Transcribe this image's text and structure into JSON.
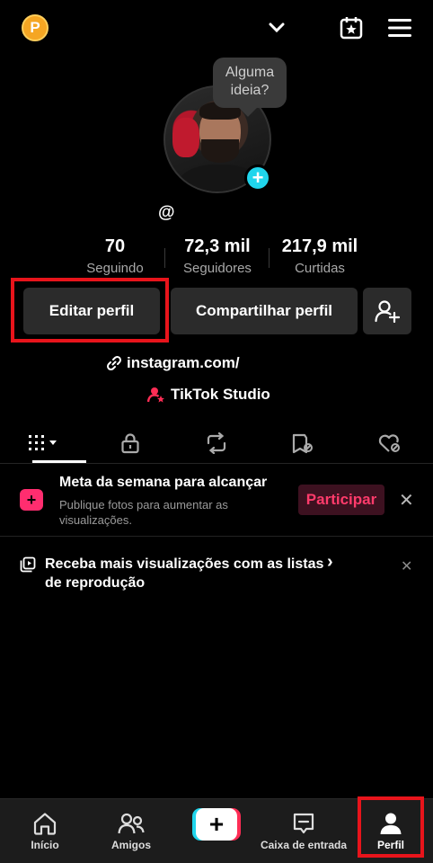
{
  "header": {
    "coin_letter": "P",
    "icons": [
      "coin-icon",
      "chevron-down-icon",
      "calendar-star-icon",
      "menu-icon"
    ]
  },
  "profile": {
    "bubble_text": "Alguma ideia?",
    "handle": "@",
    "stats": [
      {
        "value": "70",
        "label": "Seguindo"
      },
      {
        "value": "72,3 mil",
        "label": "Seguidores"
      },
      {
        "value": "217,9 mil",
        "label": "Curtidas"
      }
    ],
    "buttons": {
      "edit": "Editar perfil",
      "share": "Compartilhar perfil"
    },
    "link": "instagram.com/",
    "studio": "TikTok Studio"
  },
  "tabs": [
    "videos-grid-icon",
    "lock-icon",
    "repost-icon",
    "favorites-icon",
    "liked-icon"
  ],
  "meta_card": {
    "title": "Meta da semana para alcançar",
    "subtitle": "Publique fotos para aumentar as visualizações.",
    "cta": "Participar",
    "close": "✕"
  },
  "playlist_card": {
    "text": "Receba mais visualizações com as listas de reprodução",
    "chevron": "›",
    "close": "✕"
  },
  "bottom_nav": {
    "items": [
      {
        "label": "Início",
        "icon": "home-icon"
      },
      {
        "label": "Amigos",
        "icon": "friends-icon"
      },
      {
        "label": "",
        "icon": "create-icon"
      },
      {
        "label": "Caixa de entrada",
        "icon": "inbox-icon"
      },
      {
        "label": "Perfil",
        "icon": "profile-icon"
      }
    ],
    "create_symbol": "+"
  },
  "colors": {
    "highlight": "#e8141b",
    "accent_pink": "#ff2d55",
    "accent_cyan": "#20d5ec"
  }
}
